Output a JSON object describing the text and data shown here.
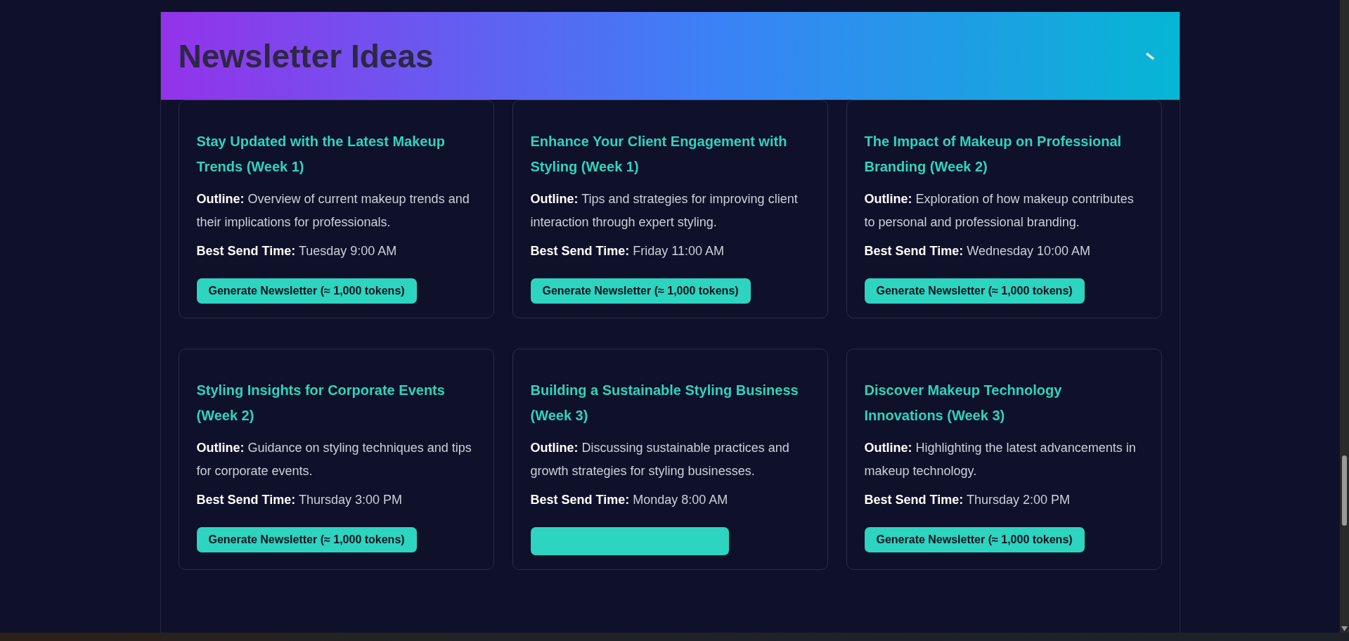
{
  "header": {
    "title": "Newsletter Ideas"
  },
  "cards": [
    {
      "title": "Stay Updated with the Latest Makeup Trends (Week 1)",
      "outline_label": "Outline:",
      "outline": "Overview of current makeup trends and their implications for professionals.",
      "send_label": "Best Send Time:",
      "send_time": "Tuesday 9:00 AM",
      "button": "Generate Newsletter (≈ 1,000 tokens)"
    },
    {
      "title": "Enhance Your Client Engagement with Styling (Week 1)",
      "outline_label": "Outline:",
      "outline": "Tips and strategies for improving client interaction through expert styling.",
      "send_label": "Best Send Time:",
      "send_time": "Friday 11:00 AM",
      "button": "Generate Newsletter (≈ 1,000 tokens)"
    },
    {
      "title": "The Impact of Makeup on Professional Branding (Week 2)",
      "outline_label": "Outline:",
      "outline": "Exploration of how makeup contributes to personal and professional branding.",
      "send_label": "Best Send Time:",
      "send_time": "Wednesday 10:00 AM",
      "button": "Generate Newsletter (≈ 1,000 tokens)"
    },
    {
      "title": "Styling Insights for Corporate Events (Week 2)",
      "outline_label": "Outline:",
      "outline": "Guidance on styling techniques and tips for corporate events.",
      "send_label": "Best Send Time:",
      "send_time": "Thursday 3:00 PM",
      "button": "Generate Newsletter (≈ 1,000 tokens)"
    },
    {
      "title": "Building a Sustainable Styling Business (Week 3)",
      "outline_label": "Outline:",
      "outline": "Discussing sustainable practices and growth strategies for styling businesses.",
      "send_label": "Best Send Time:",
      "send_time": "Monday 8:00 AM"
    },
    {
      "title": "Discover Makeup Technology Innovations (Week 3)",
      "outline_label": "Outline:",
      "outline": "Highlighting the latest advancements in makeup technology.",
      "send_label": "Best Send Time:",
      "send_time": "Thursday 2:00 PM",
      "button": "Generate Newsletter (≈ 1,000 tokens)"
    }
  ]
}
